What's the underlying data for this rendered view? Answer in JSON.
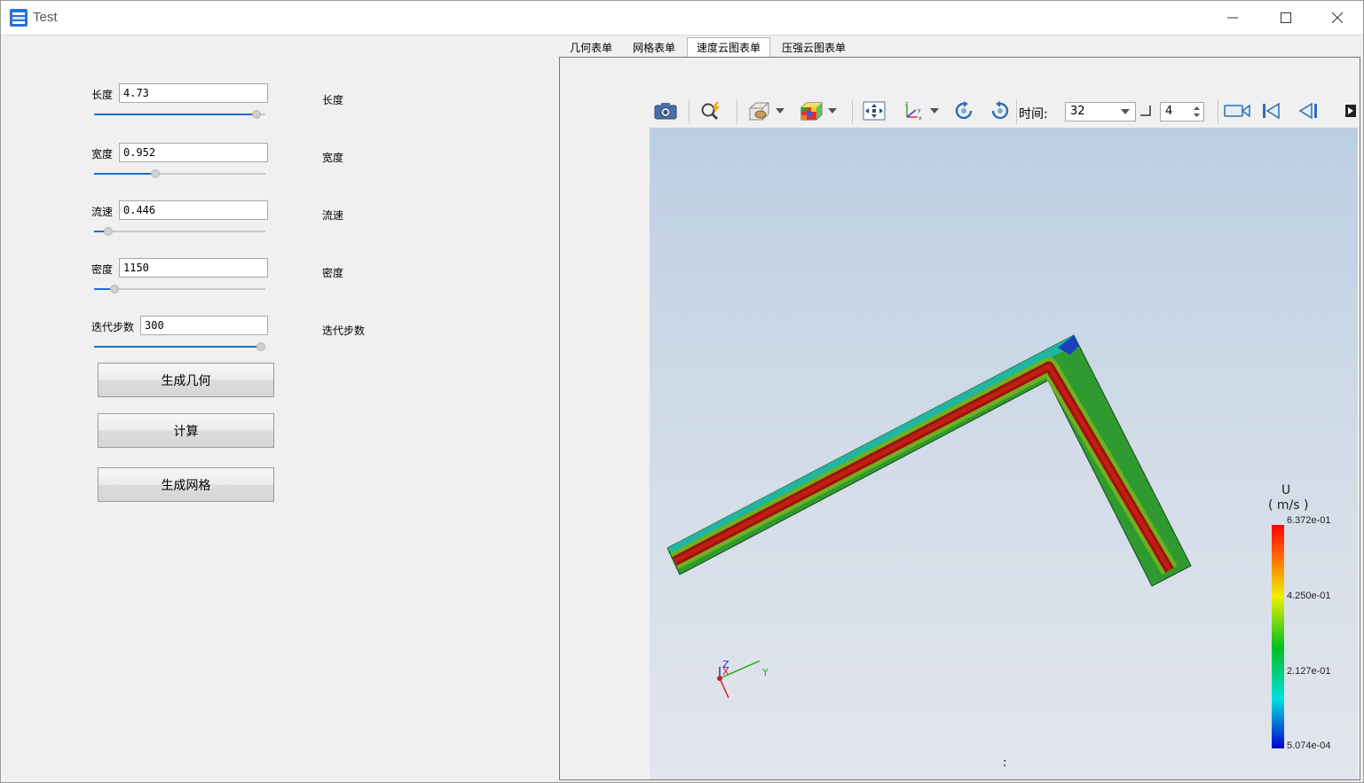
{
  "window": {
    "title": "Test"
  },
  "form": {
    "fields": [
      {
        "label": "长度",
        "value": "4.73",
        "side_label": "长度",
        "slider_fraction": 0.97
      },
      {
        "label": "宽度",
        "value": "0.952",
        "side_label": "宽度",
        "slider_fraction": 0.35
      },
      {
        "label": "流速",
        "value": "0.446",
        "side_label": "流速",
        "slider_fraction": 0.06
      },
      {
        "label": "密度",
        "value": "1150",
        "side_label": "密度",
        "slider_fraction": 0.1
      },
      {
        "label": "迭代步数",
        "value": "300",
        "side_label": "迭代步数",
        "slider_fraction": 1.0
      }
    ],
    "buttons": {
      "generate_geometry": "生成几何",
      "compute": "计算",
      "generate_mesh": "生成网格"
    }
  },
  "tabs": [
    {
      "label": "几何表单",
      "active": false
    },
    {
      "label": "网格表单",
      "active": false
    },
    {
      "label": "速度云图表单",
      "active": true
    },
    {
      "label": "压强云图表单",
      "active": false
    }
  ],
  "viewer": {
    "time_label": "时间:",
    "time_value": "32",
    "step_value": "4",
    "icons": [
      "camera-icon",
      "zoom-lightning-icon",
      "slice-plane-icon",
      "color-cube-icon",
      "fit-view-icon",
      "axes-orient-icon",
      "rotate-cw-icon",
      "rotate-ccw-icon",
      "record-video-icon",
      "first-frame-icon",
      "prev-frame-icon"
    ],
    "legend": {
      "title": "U",
      "unit": "( m/s )",
      "ticks": [
        "6.372e-01",
        "4.250e-01",
        "2.127e-01",
        "5.074e-04"
      ]
    },
    "axes": {
      "x": "X",
      "y": "Y",
      "z": "Z"
    },
    "status_text": ":"
  }
}
